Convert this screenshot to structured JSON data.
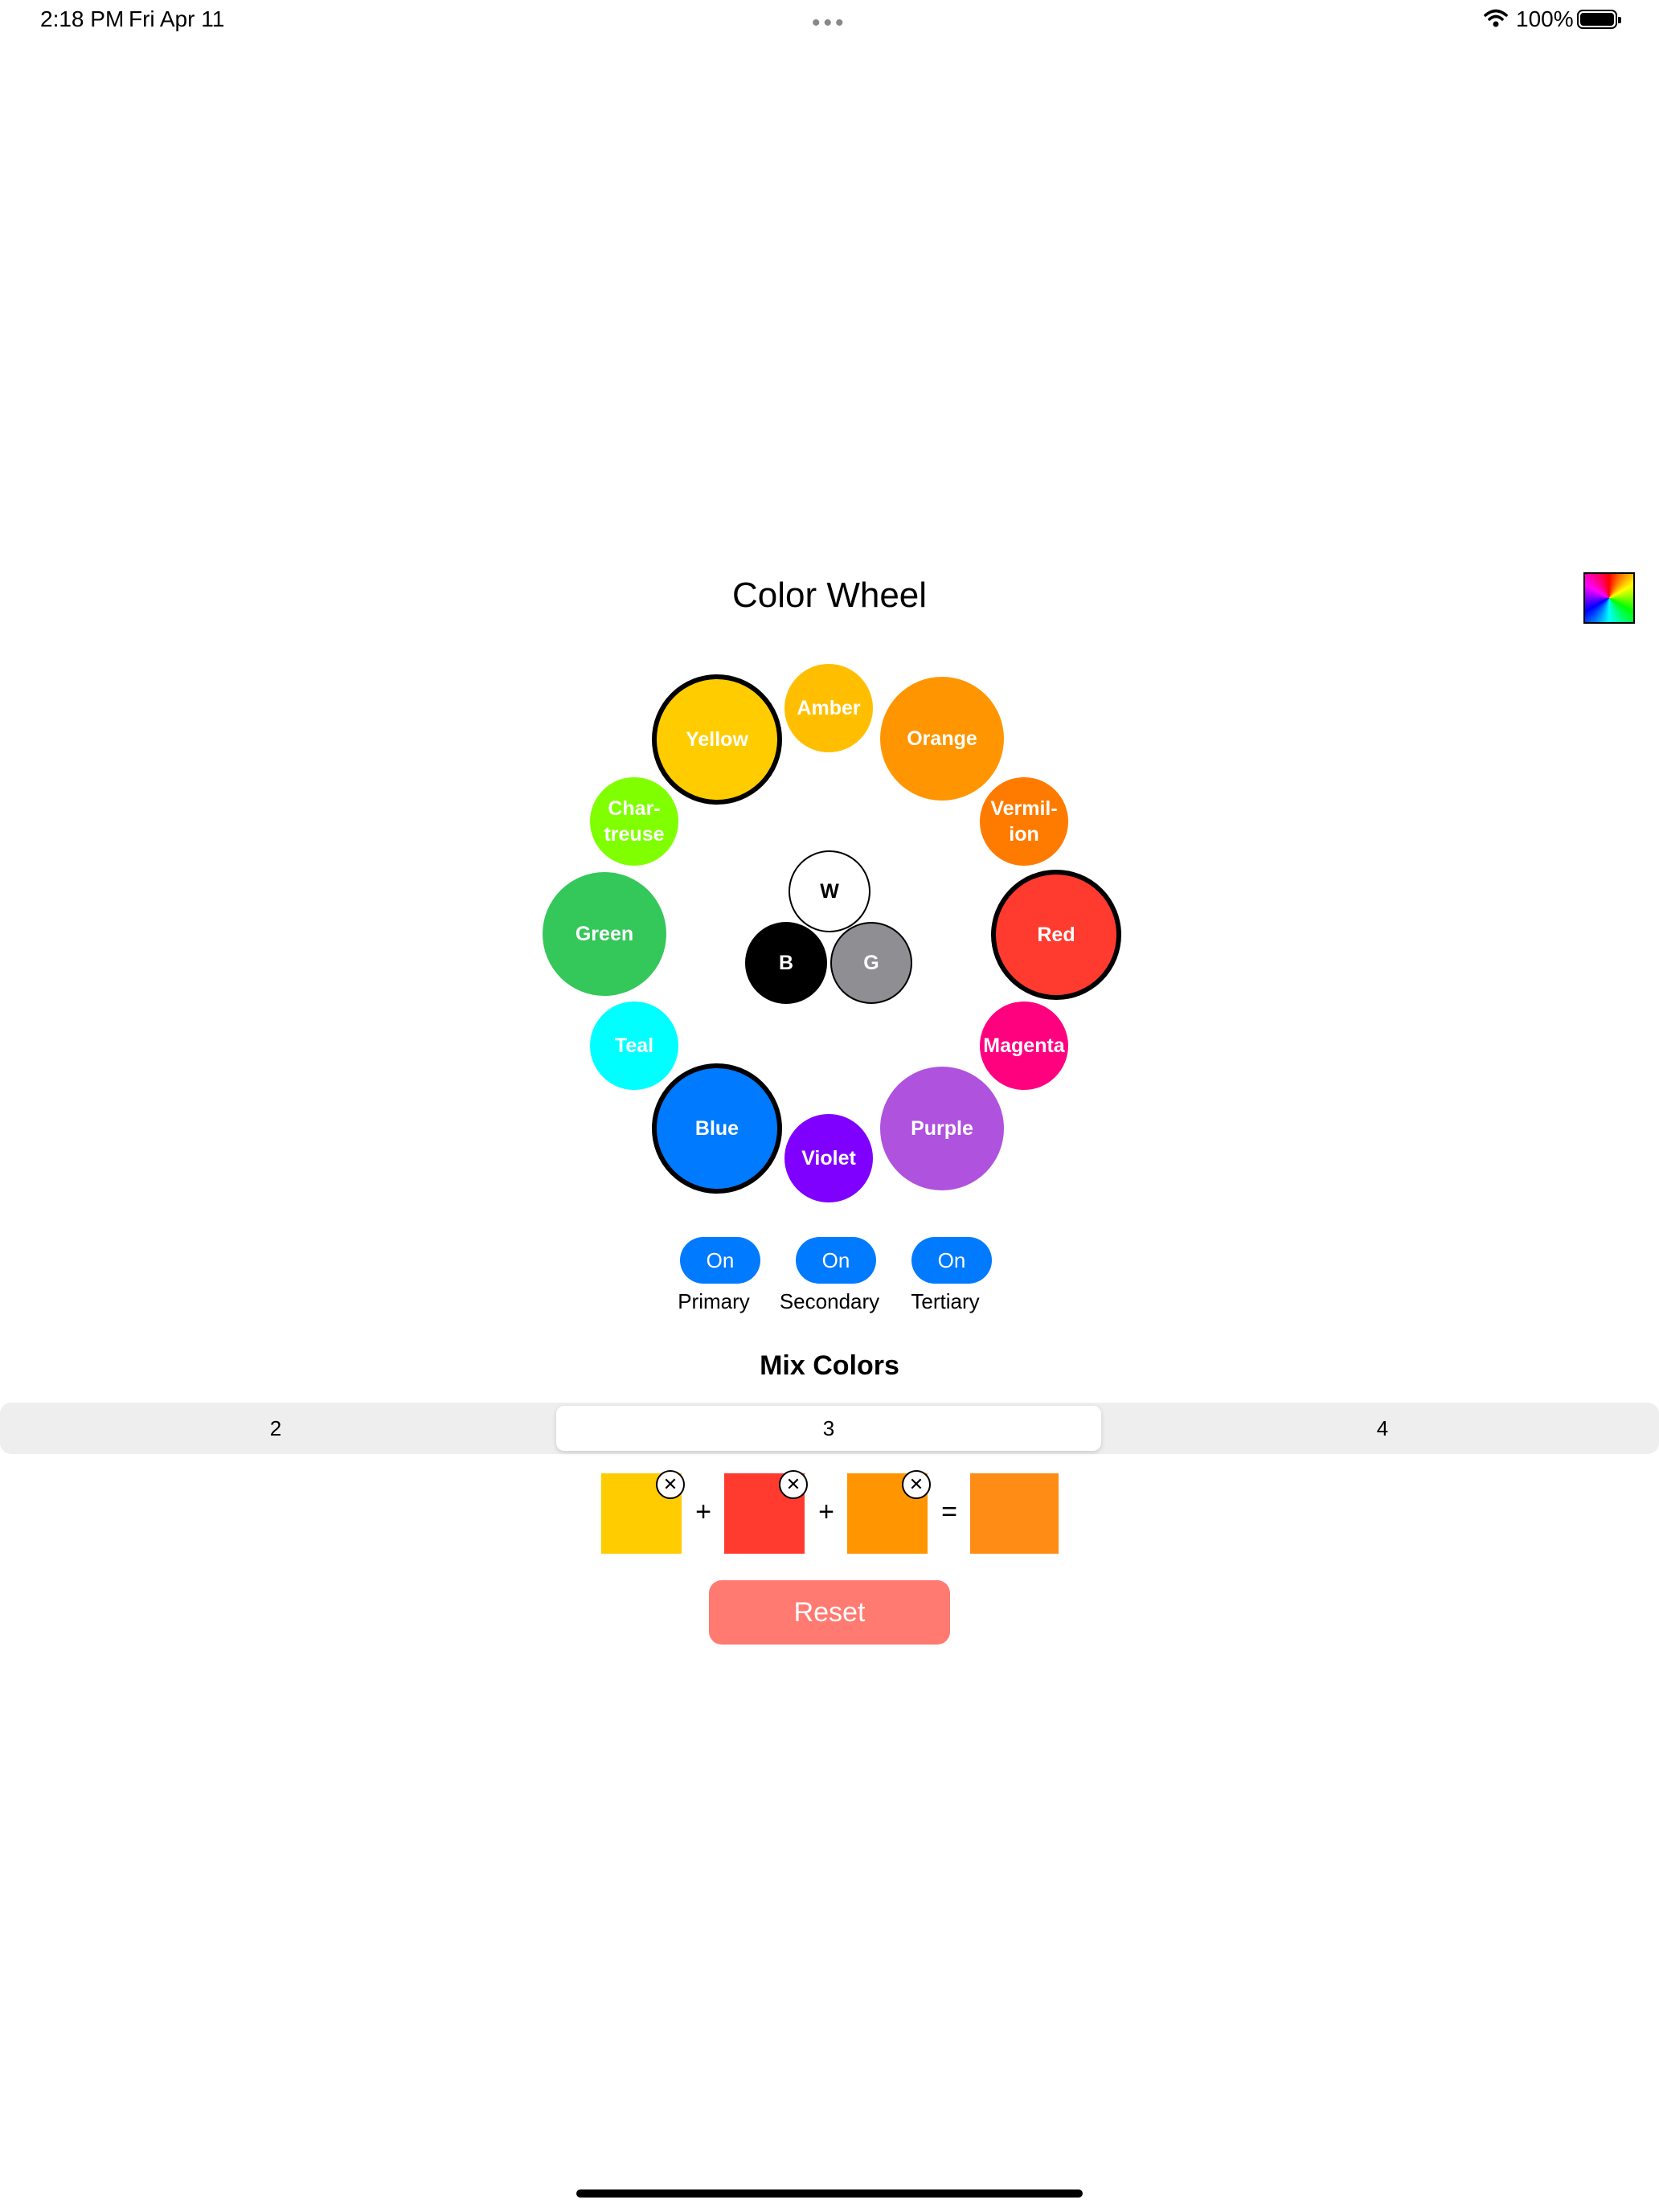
{
  "status_bar": {
    "time": "2:18 PM",
    "date": "Fri Apr 11",
    "dots": "•••",
    "battery": "100%"
  },
  "title": "Color Wheel",
  "wheel": {
    "yellow": {
      "label": "Yellow",
      "color": "#ffcc00",
      "selected": true
    },
    "amber": {
      "label": "Amber",
      "color": "#ffbf00"
    },
    "orange": {
      "label": "Orange",
      "color": "#ff9500"
    },
    "chartreuse": {
      "label": "Char-\ntreuse",
      "color": "#80ff00"
    },
    "vermilion": {
      "label": "Vermil-\nion",
      "color": "#ff7b00"
    },
    "green": {
      "label": "Green",
      "color": "#34c759"
    },
    "red": {
      "label": "Red",
      "color": "#ff3b30",
      "selected": true
    },
    "teal": {
      "label": "Teal",
      "color": "#00ffff"
    },
    "magenta": {
      "label": "Magenta",
      "color": "#ff007f"
    },
    "blue": {
      "label": "Blue",
      "color": "#007aff",
      "selected": true
    },
    "violet": {
      "label": "Violet",
      "color": "#8000ff"
    },
    "purple": {
      "label": "Purple",
      "color": "#af52de"
    },
    "white": {
      "label": "W",
      "color": "#ffffff"
    },
    "black": {
      "label": "B",
      "color": "#000000"
    },
    "gray": {
      "label": "G",
      "color": "#8e8e93"
    }
  },
  "toggles": [
    {
      "state": "On",
      "label": "Primary"
    },
    {
      "state": "On",
      "label": "Secondary"
    },
    {
      "state": "On",
      "label": "Tertiary"
    }
  ],
  "mix": {
    "title": "Mix Colors",
    "segments": [
      "2",
      "3",
      "4"
    ],
    "selected_segment": "3",
    "swatches": [
      {
        "color": "#ffcc00",
        "remove": "✕"
      },
      {
        "color": "#ff3b30",
        "remove": "✕"
      },
      {
        "color": "#ff9500",
        "remove": "✕"
      }
    ],
    "plus": "+",
    "equals": "=",
    "result_color": "#ff8c14"
  },
  "reset_label": "Reset"
}
